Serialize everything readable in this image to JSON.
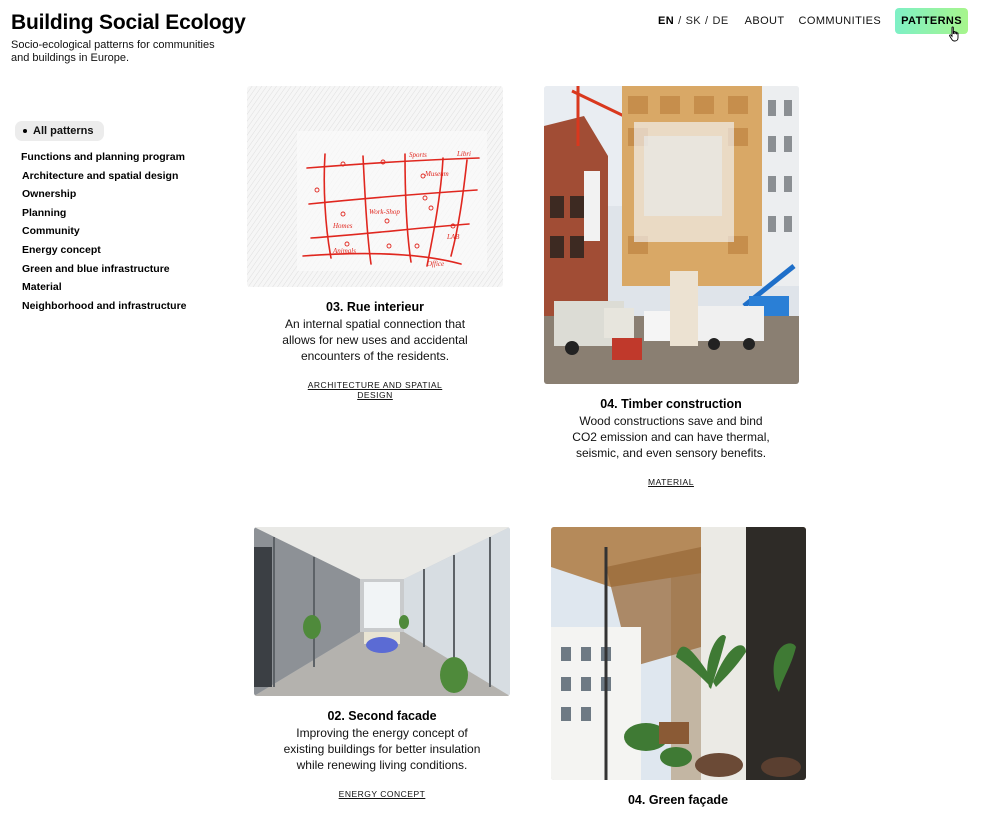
{
  "site": {
    "title": "Building Social Ecology",
    "subtitle": "Socio-ecological patterns for communities and buildings in Europe."
  },
  "nav": {
    "languages": [
      {
        "label": "EN",
        "active": true
      },
      {
        "label": "SK",
        "active": false
      },
      {
        "label": "DE",
        "active": false
      }
    ],
    "links": [
      "ABOUT",
      "COMMUNITIES",
      "PATTERNS"
    ],
    "accent": "#8ef2b0"
  },
  "sidebar": {
    "all_label": "All patterns",
    "filters": [
      "Functions and planning program",
      "Architecture and spatial design",
      "Ownership",
      "Planning",
      "Community",
      "Energy concept",
      "Green and blue infrastructure",
      "Material",
      "Neighborhood and infrastructure"
    ]
  },
  "cards": [
    {
      "title": "03. Rue interieur",
      "description": "An internal spatial connection that allows for new uses and accidental encounters of the residents.",
      "tag": "ARCHITECTURE AND SPATIAL DESIGN",
      "sketch_labels": [
        "Sports",
        "Libri",
        "Museum",
        "Work-Shop",
        "Homes",
        "Animals",
        "LAB",
        "Office"
      ]
    },
    {
      "title": "04. Timber construction",
      "description": "Wood constructions save and bind CO2 emission and can have thermal, seismic, and even sensory benefits.",
      "tag": "MATERIAL"
    },
    {
      "title": "02. Second facade",
      "description": "Improving the energy concept of existing buildings for better insulation while renewing living conditions.",
      "tag": "ENERGY CONCEPT"
    },
    {
      "title": "04. Green façade",
      "description": "",
      "tag": ""
    }
  ]
}
